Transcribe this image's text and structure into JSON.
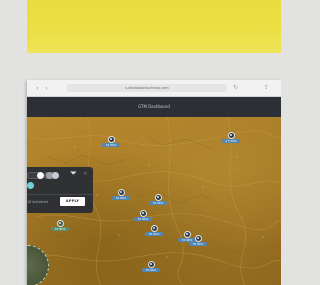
{
  "browser": {
    "url": "s.dashboardurlmap.com"
  },
  "app": {
    "title": "GTM Dashboard"
  },
  "filter_panel": {
    "count_text": "18 Activated",
    "apply_label": "APPLY"
  },
  "markers": [
    {
      "label": "55 NDS"
    },
    {
      "label": "4.5 NDS"
    },
    {
      "label": "55 NDS"
    },
    {
      "label": "55 NDS"
    },
    {
      "label": "55 NDS"
    },
    {
      "label": "55 NDS"
    },
    {
      "label": "55 NDS"
    },
    {
      "label": "55 NDS"
    },
    {
      "label": "55 NDS"
    },
    {
      "label": "55 NDS"
    }
  ],
  "colors": {
    "banner_yellow": "#ece046",
    "app_header": "#2c2f35",
    "map_terrain": "#a87b26",
    "marker_tag": "#4f88b8",
    "panel_bg": "#2b2e34"
  },
  "icons": [
    "back-arrow-icon",
    "forward-arrow-icon",
    "reload-icon",
    "share-icon",
    "filter-funnel-icon",
    "close-icon",
    "marker-pin-icon",
    "location-pin-icon"
  ]
}
